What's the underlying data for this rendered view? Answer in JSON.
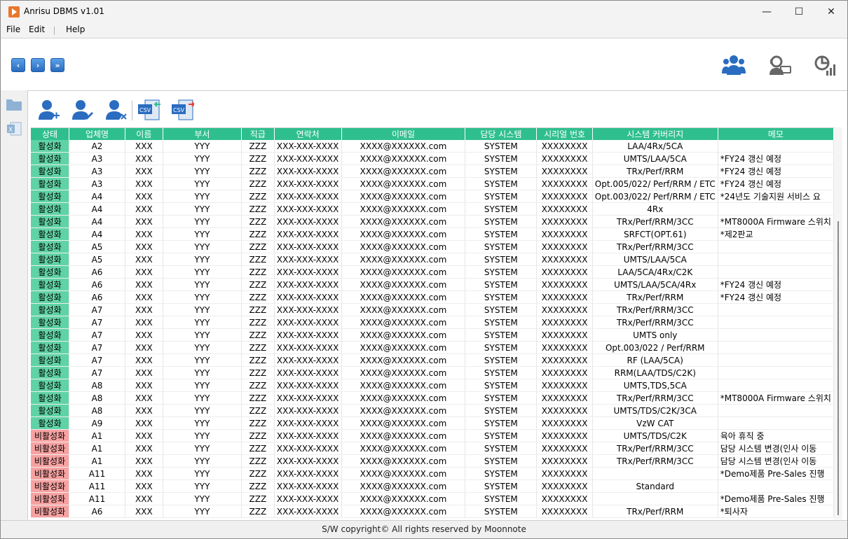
{
  "window": {
    "title": "Anrisu DBMS v1.01"
  },
  "titlebar_buttons": {
    "minimize": "—",
    "maximize": "☐",
    "close": "✕"
  },
  "menu": [
    "File",
    "Edit",
    "Help"
  ],
  "nav": {
    "first": "‹",
    "next": "›",
    "last": "»"
  },
  "table": {
    "headers": [
      "상태",
      "업체명",
      "이름",
      "부서",
      "직급",
      "연락처",
      "이메일",
      "담당 시스템",
      "시리얼 번호",
      "시스템 커버리지",
      "메모"
    ],
    "rows": [
      [
        "활성화",
        "A2",
        "XXX",
        "YYY",
        "ZZZ",
        "XXX-XXX-XXXX",
        "XXXX@XXXXXX.com",
        "SYSTEM",
        "XXXXXXXX",
        "LAA/4Rx/5CA",
        ""
      ],
      [
        "활성화",
        "A3",
        "XXX",
        "YYY",
        "ZZZ",
        "XXX-XXX-XXXX",
        "XXXX@XXXXXX.com",
        "SYSTEM",
        "XXXXXXXX",
        "UMTS/LAA/5CA",
        "*FY24 갱신 예정"
      ],
      [
        "활성화",
        "A3",
        "XXX",
        "YYY",
        "ZZZ",
        "XXX-XXX-XXXX",
        "XXXX@XXXXXX.com",
        "SYSTEM",
        "XXXXXXXX",
        "TRx/Perf/RRM",
        "*FY24 갱신 예정"
      ],
      [
        "활성화",
        "A3",
        "XXX",
        "YYY",
        "ZZZ",
        "XXX-XXX-XXXX",
        "XXXX@XXXXXX.com",
        "SYSTEM",
        "XXXXXXXX",
        "Opt.005/022/ Perf/RRM / ETC",
        "*FY24 갱신 예정"
      ],
      [
        "활성화",
        "A4",
        "XXX",
        "YYY",
        "ZZZ",
        "XXX-XXX-XXXX",
        "XXXX@XXXXXX.com",
        "SYSTEM",
        "XXXXXXXX",
        "Opt.003/022/ Perf/RRM / ETC",
        "*24년도 기술지원 서비스 요"
      ],
      [
        "활성화",
        "A4",
        "XXX",
        "YYY",
        "ZZZ",
        "XXX-XXX-XXXX",
        "XXXX@XXXXXX.com",
        "SYSTEM",
        "XXXXXXXX",
        "4Rx",
        ""
      ],
      [
        "활성화",
        "A4",
        "XXX",
        "YYY",
        "ZZZ",
        "XXX-XXX-XXXX",
        "XXXX@XXXXXX.com",
        "SYSTEM",
        "XXXXXXXX",
        "TRx/Perf/RRM/3CC",
        "*MT8000A Firmware 스위치"
      ],
      [
        "활성화",
        "A4",
        "XXX",
        "YYY",
        "ZZZ",
        "XXX-XXX-XXXX",
        "XXXX@XXXXXX.com",
        "SYSTEM",
        "XXXXXXXX",
        "SRFCT(OPT.61)",
        "*제2판교"
      ],
      [
        "활성화",
        "A5",
        "XXX",
        "YYY",
        "ZZZ",
        "XXX-XXX-XXXX",
        "XXXX@XXXXXX.com",
        "SYSTEM",
        "XXXXXXXX",
        "TRx/Perf/RRM/3CC",
        ""
      ],
      [
        "활성화",
        "A5",
        "XXX",
        "YYY",
        "ZZZ",
        "XXX-XXX-XXXX",
        "XXXX@XXXXXX.com",
        "SYSTEM",
        "XXXXXXXX",
        "UMTS/LAA/5CA",
        ""
      ],
      [
        "활성화",
        "A6",
        "XXX",
        "YYY",
        "ZZZ",
        "XXX-XXX-XXXX",
        "XXXX@XXXXXX.com",
        "SYSTEM",
        "XXXXXXXX",
        "LAA/5CA/4Rx/C2K",
        ""
      ],
      [
        "활성화",
        "A6",
        "XXX",
        "YYY",
        "ZZZ",
        "XXX-XXX-XXXX",
        "XXXX@XXXXXX.com",
        "SYSTEM",
        "XXXXXXXX",
        "UMTS/LAA/5CA/4Rx",
        "*FY24 갱신 예정"
      ],
      [
        "활성화",
        "A6",
        "XXX",
        "YYY",
        "ZZZ",
        "XXX-XXX-XXXX",
        "XXXX@XXXXXX.com",
        "SYSTEM",
        "XXXXXXXX",
        "TRx/Perf/RRM",
        "*FY24 갱신 예정"
      ],
      [
        "활성화",
        "A7",
        "XXX",
        "YYY",
        "ZZZ",
        "XXX-XXX-XXXX",
        "XXXX@XXXXXX.com",
        "SYSTEM",
        "XXXXXXXX",
        "TRx/Perf/RRM/3CC",
        ""
      ],
      [
        "활성화",
        "A7",
        "XXX",
        "YYY",
        "ZZZ",
        "XXX-XXX-XXXX",
        "XXXX@XXXXXX.com",
        "SYSTEM",
        "XXXXXXXX",
        "TRx/Perf/RRM/3CC",
        ""
      ],
      [
        "활성화",
        "A7",
        "XXX",
        "YYY",
        "ZZZ",
        "XXX-XXX-XXXX",
        "XXXX@XXXXXX.com",
        "SYSTEM",
        "XXXXXXXX",
        "UMTS only",
        ""
      ],
      [
        "활성화",
        "A7",
        "XXX",
        "YYY",
        "ZZZ",
        "XXX-XXX-XXXX",
        "XXXX@XXXXXX.com",
        "SYSTEM",
        "XXXXXXXX",
        "Opt.003/022 / Perf/RRM",
        ""
      ],
      [
        "활성화",
        "A7",
        "XXX",
        "YYY",
        "ZZZ",
        "XXX-XXX-XXXX",
        "XXXX@XXXXXX.com",
        "SYSTEM",
        "XXXXXXXX",
        "RF (LAA/5CA)",
        ""
      ],
      [
        "활성화",
        "A7",
        "XXX",
        "YYY",
        "ZZZ",
        "XXX-XXX-XXXX",
        "XXXX@XXXXXX.com",
        "SYSTEM",
        "XXXXXXXX",
        "RRM(LAA/TDS/C2K)",
        ""
      ],
      [
        "활성화",
        "A8",
        "XXX",
        "YYY",
        "ZZZ",
        "XXX-XXX-XXXX",
        "XXXX@XXXXXX.com",
        "SYSTEM",
        "XXXXXXXX",
        "UMTS,TDS,5CA",
        ""
      ],
      [
        "활성화",
        "A8",
        "XXX",
        "YYY",
        "ZZZ",
        "XXX-XXX-XXXX",
        "XXXX@XXXXXX.com",
        "SYSTEM",
        "XXXXXXXX",
        "TRx/Perf/RRM/3CC",
        "*MT8000A Firmware 스위치"
      ],
      [
        "활성화",
        "A8",
        "XXX",
        "YYY",
        "ZZZ",
        "XXX-XXX-XXXX",
        "XXXX@XXXXXX.com",
        "SYSTEM",
        "XXXXXXXX",
        "UMTS/TDS/C2K/3CA",
        ""
      ],
      [
        "활성화",
        "A9",
        "XXX",
        "YYY",
        "ZZZ",
        "XXX-XXX-XXXX",
        "XXXX@XXXXXX.com",
        "SYSTEM",
        "XXXXXXXX",
        "VzW CAT",
        ""
      ],
      [
        "비활성화",
        "A1",
        "XXX",
        "YYY",
        "ZZZ",
        "XXX-XXX-XXXX",
        "XXXX@XXXXXX.com",
        "SYSTEM",
        "XXXXXXXX",
        "UMTS/TDS/C2K",
        "육아 휴직 중"
      ],
      [
        "비활성화",
        "A1",
        "XXX",
        "YYY",
        "ZZZ",
        "XXX-XXX-XXXX",
        "XXXX@XXXXXX.com",
        "SYSTEM",
        "XXXXXXXX",
        "TRx/Perf/RRM/3CC",
        "담당 시스템 변경(인사 이동"
      ],
      [
        "비활성화",
        "A1",
        "XXX",
        "YYY",
        "ZZZ",
        "XXX-XXX-XXXX",
        "XXXX@XXXXXX.com",
        "SYSTEM",
        "XXXXXXXX",
        "TRx/Perf/RRM/3CC",
        "담당 시스템 변경(인사 이동"
      ],
      [
        "비활성화",
        "A11",
        "XXX",
        "YYY",
        "ZZZ",
        "XXX-XXX-XXXX",
        "XXXX@XXXXXX.com",
        "SYSTEM",
        "XXXXXXXX",
        "",
        "*Demo제품 Pre-Sales 진행"
      ],
      [
        "비활성화",
        "A11",
        "XXX",
        "YYY",
        "ZZZ",
        "XXX-XXX-XXXX",
        "XXXX@XXXXXX.com",
        "SYSTEM",
        "XXXXXXXX",
        "Standard",
        ""
      ],
      [
        "비활성화",
        "A11",
        "XXX",
        "YYY",
        "ZZZ",
        "XXX-XXX-XXXX",
        "XXXX@XXXXXX.com",
        "SYSTEM",
        "XXXXXXXX",
        "",
        "*Demo제품 Pre-Sales 진행"
      ],
      [
        "비활성화",
        "A6",
        "XXX",
        "YYY",
        "ZZZ",
        "XXX-XXX-XXXX",
        "XXXX@XXXXXX.com",
        "SYSTEM",
        "XXXXXXXX",
        "TRx/Perf/RRM",
        "*퇴사자"
      ]
    ]
  },
  "icons": {
    "nav": [
      "first-page-icon",
      "next-page-icon",
      "last-page-icon"
    ],
    "top_right": [
      "users-group-icon",
      "support-agent-icon",
      "statistics-icon"
    ],
    "toolbar": [
      "add-user-icon",
      "edit-user-icon",
      "delete-user-icon",
      "csv-import-icon",
      "csv-export-icon"
    ],
    "left": [
      "folder-icon",
      "excel-icon"
    ]
  },
  "colors": {
    "header": "#2fbf8f",
    "active": "#5fd3a6",
    "inactive": "#f7a1a1",
    "accent": "#2a6cc0"
  },
  "footer": "S/W copyright© All rights reserved by Moonnote"
}
